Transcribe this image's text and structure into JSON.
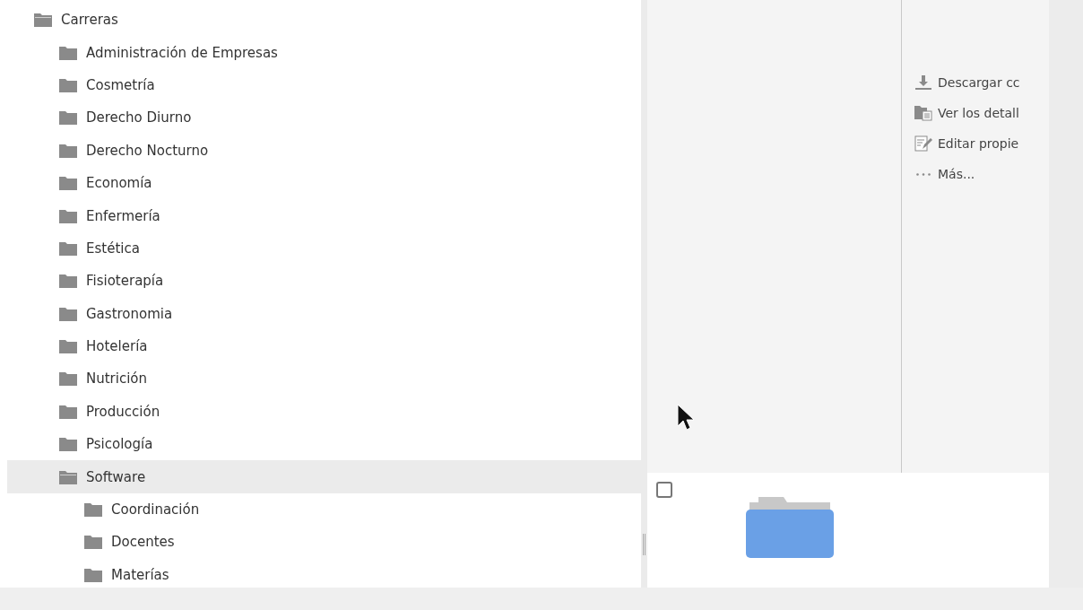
{
  "tree": [
    {
      "label": "Carreras",
      "expanded": true,
      "selected": false,
      "children": [
        {
          "label": "Administración de Empresas",
          "expanded": false,
          "selected": false
        },
        {
          "label": "Cosmetría",
          "expanded": false,
          "selected": false
        },
        {
          "label": "Derecho Diurno",
          "expanded": false,
          "selected": false
        },
        {
          "label": "Derecho Nocturno",
          "expanded": false,
          "selected": false
        },
        {
          "label": "Economía",
          "expanded": false,
          "selected": false
        },
        {
          "label": "Enfermería",
          "expanded": false,
          "selected": false
        },
        {
          "label": "Estética",
          "expanded": false,
          "selected": false
        },
        {
          "label": "Fisioterapía",
          "expanded": false,
          "selected": false
        },
        {
          "label": "Gastronomia",
          "expanded": false,
          "selected": false
        },
        {
          "label": "Hotelería",
          "expanded": false,
          "selected": false
        },
        {
          "label": "Nutrición",
          "expanded": false,
          "selected": false
        },
        {
          "label": "Producción",
          "expanded": false,
          "selected": false
        },
        {
          "label": "Psicología",
          "expanded": false,
          "selected": false
        },
        {
          "label": "Software",
          "expanded": true,
          "selected": true,
          "children": [
            {
              "label": "Coordinación",
              "expanded": false,
              "selected": false
            },
            {
              "label": "Docentes",
              "expanded": false,
              "selected": false
            },
            {
              "label": "Materías",
              "expanded": false,
              "selected": false
            }
          ]
        }
      ]
    }
  ],
  "actions": [
    {
      "kind": "download",
      "label": "Descargar cc"
    },
    {
      "kind": "details",
      "label": "Ver los detall"
    },
    {
      "kind": "edit",
      "label": "Editar propie"
    },
    {
      "kind": "more",
      "label": "Más..."
    }
  ],
  "file_row": {
    "checked": false
  }
}
